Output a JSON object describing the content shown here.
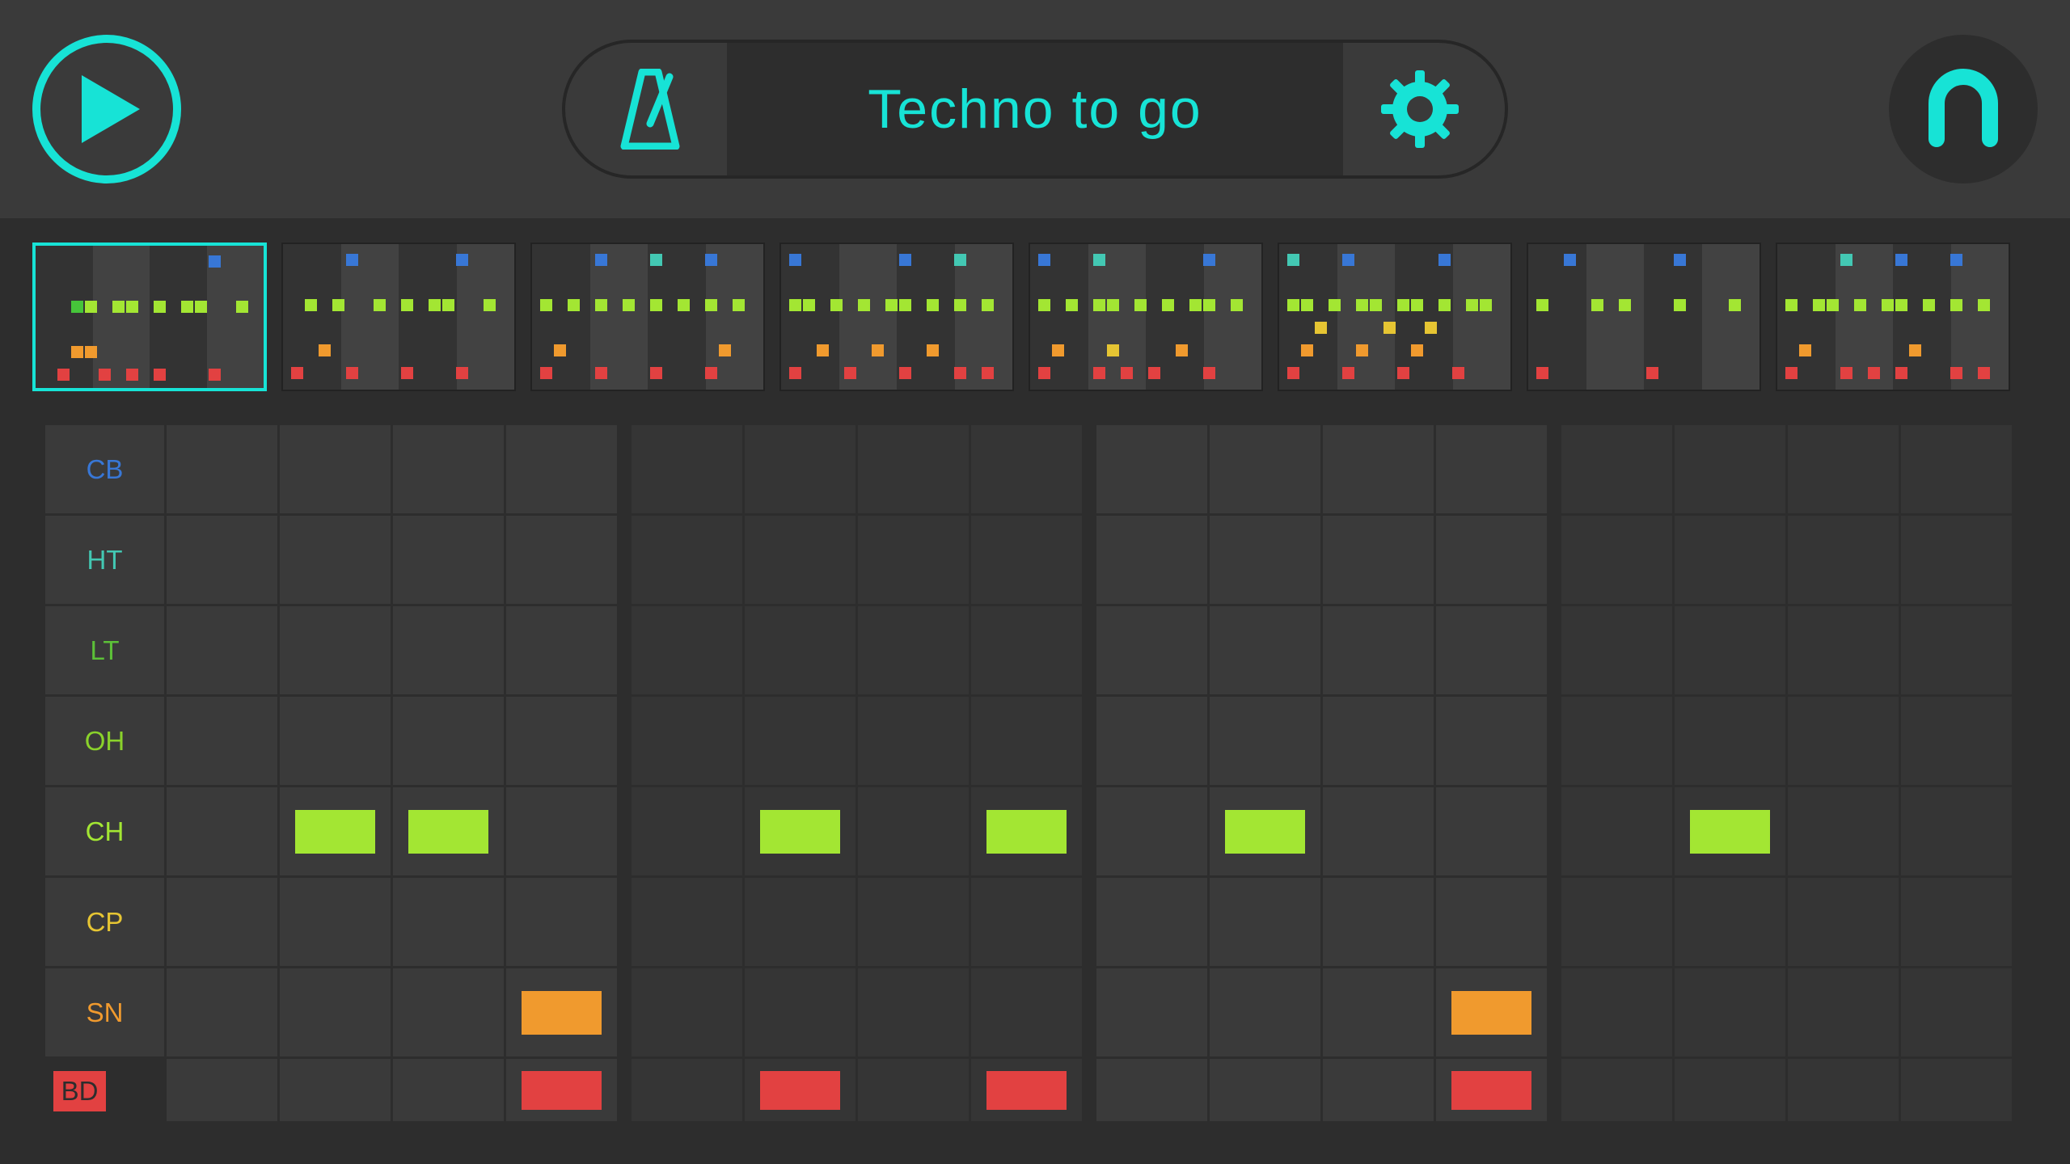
{
  "header": {
    "title": "Techno to go",
    "play_icon": "play",
    "metronome_icon": "metronome",
    "settings_icon": "gear",
    "logo_icon": "arch"
  },
  "colors": {
    "accent": "#17e3d6",
    "cb": "#3877d6",
    "ht": "#43c8b3",
    "lt": "#5cc038",
    "oh": "#8ad22b",
    "ch": "#a3e633",
    "cp": "#e6c533",
    "sn": "#f09a2e",
    "bd": "#e24141"
  },
  "tracks": [
    {
      "id": "cb",
      "label": "CB",
      "steps": [],
      "labelColor": "#3877d6"
    },
    {
      "id": "ht",
      "label": "HT",
      "steps": [],
      "labelColor": "#43c8b3"
    },
    {
      "id": "lt",
      "label": "LT",
      "steps": [],
      "labelColor": "#5cc038"
    },
    {
      "id": "oh",
      "label": "OH",
      "steps": [],
      "labelColor": "#8ad22b"
    },
    {
      "id": "ch",
      "label": "CH",
      "steps": [
        1,
        2,
        5,
        7,
        9,
        13
      ],
      "labelColor": "#a3e633",
      "color": "#a3e633"
    },
    {
      "id": "cp",
      "label": "CP",
      "steps": [],
      "labelColor": "#e6c533"
    },
    {
      "id": "sn",
      "label": "SN",
      "steps": [
        3,
        11
      ],
      "labelColor": "#f09a2e",
      "color": "#f09a2e"
    },
    {
      "id": "bd",
      "label": "BD",
      "steps": [
        3,
        5,
        7,
        11
      ],
      "labelColor": "#e24141",
      "color": "#e24141"
    }
  ],
  "patterns": {
    "active": 0,
    "count": 8,
    "items": [
      {
        "dots": [
          [
            12,
            0,
            "#3877d6"
          ],
          [
            2,
            2,
            "#46c53a"
          ],
          [
            3,
            2,
            "#a3e633"
          ],
          [
            5,
            2,
            "#a3e633"
          ],
          [
            6,
            2,
            "#a3e633"
          ],
          [
            8,
            2,
            "#a3e633"
          ],
          [
            10,
            2,
            "#a3e633"
          ],
          [
            11,
            2,
            "#a3e633"
          ],
          [
            14,
            2,
            "#a3e633"
          ],
          [
            2,
            4,
            "#f09a2e"
          ],
          [
            3,
            4,
            "#f09a2e"
          ],
          [
            1,
            5,
            "#e24141"
          ],
          [
            4,
            5,
            "#e24141"
          ],
          [
            6,
            5,
            "#e24141"
          ],
          [
            8,
            5,
            "#e24141"
          ],
          [
            12,
            5,
            "#e24141"
          ]
        ]
      },
      {
        "dots": [
          [
            4,
            0,
            "#3877d6"
          ],
          [
            12,
            0,
            "#3877d6"
          ],
          [
            1,
            2,
            "#a3e633"
          ],
          [
            3,
            2,
            "#a3e633"
          ],
          [
            6,
            2,
            "#a3e633"
          ],
          [
            8,
            2,
            "#a3e633"
          ],
          [
            10,
            2,
            "#a3e633"
          ],
          [
            11,
            2,
            "#a3e633"
          ],
          [
            14,
            2,
            "#a3e633"
          ],
          [
            2,
            4,
            "#f09a2e"
          ],
          [
            0,
            5,
            "#e24141"
          ],
          [
            4,
            5,
            "#e24141"
          ],
          [
            8,
            5,
            "#e24141"
          ],
          [
            12,
            5,
            "#e24141"
          ]
        ]
      },
      {
        "dots": [
          [
            4,
            0,
            "#3877d6"
          ],
          [
            8,
            0,
            "#43c8b3"
          ],
          [
            12,
            0,
            "#3877d6"
          ],
          [
            0,
            2,
            "#a3e633"
          ],
          [
            2,
            2,
            "#a3e633"
          ],
          [
            4,
            2,
            "#a3e633"
          ],
          [
            6,
            2,
            "#a3e633"
          ],
          [
            8,
            2,
            "#a3e633"
          ],
          [
            10,
            2,
            "#a3e633"
          ],
          [
            12,
            2,
            "#a3e633"
          ],
          [
            14,
            2,
            "#a3e633"
          ],
          [
            1,
            4,
            "#f09a2e"
          ],
          [
            13,
            4,
            "#f09a2e"
          ],
          [
            0,
            5,
            "#e24141"
          ],
          [
            4,
            5,
            "#e24141"
          ],
          [
            8,
            5,
            "#e24141"
          ],
          [
            12,
            5,
            "#e24141"
          ]
        ]
      },
      {
        "dots": [
          [
            0,
            0,
            "#3877d6"
          ],
          [
            8,
            0,
            "#3877d6"
          ],
          [
            12,
            0,
            "#43c8b3"
          ],
          [
            0,
            2,
            "#a3e633"
          ],
          [
            1,
            2,
            "#a3e633"
          ],
          [
            3,
            2,
            "#a3e633"
          ],
          [
            5,
            2,
            "#a3e633"
          ],
          [
            7,
            2,
            "#a3e633"
          ],
          [
            8,
            2,
            "#a3e633"
          ],
          [
            10,
            2,
            "#a3e633"
          ],
          [
            12,
            2,
            "#a3e633"
          ],
          [
            14,
            2,
            "#a3e633"
          ],
          [
            2,
            4,
            "#f09a2e"
          ],
          [
            6,
            4,
            "#f09a2e"
          ],
          [
            10,
            4,
            "#f09a2e"
          ],
          [
            0,
            5,
            "#e24141"
          ],
          [
            4,
            5,
            "#e24141"
          ],
          [
            8,
            5,
            "#e24141"
          ],
          [
            12,
            5,
            "#e24141"
          ],
          [
            14,
            5,
            "#e24141"
          ]
        ]
      },
      {
        "dots": [
          [
            0,
            0,
            "#3877d6"
          ],
          [
            4,
            0,
            "#43c8b3"
          ],
          [
            12,
            0,
            "#3877d6"
          ],
          [
            0,
            2,
            "#a3e633"
          ],
          [
            2,
            2,
            "#a3e633"
          ],
          [
            4,
            2,
            "#a3e633"
          ],
          [
            5,
            2,
            "#a3e633"
          ],
          [
            7,
            2,
            "#a3e633"
          ],
          [
            9,
            2,
            "#a3e633"
          ],
          [
            11,
            2,
            "#a3e633"
          ],
          [
            12,
            2,
            "#a3e633"
          ],
          [
            14,
            2,
            "#a3e633"
          ],
          [
            1,
            4,
            "#f09a2e"
          ],
          [
            5,
            4,
            "#e6c533"
          ],
          [
            10,
            4,
            "#f09a2e"
          ],
          [
            0,
            5,
            "#e24141"
          ],
          [
            4,
            5,
            "#e24141"
          ],
          [
            6,
            5,
            "#e24141"
          ],
          [
            8,
            5,
            "#e24141"
          ],
          [
            12,
            5,
            "#e24141"
          ]
        ]
      },
      {
        "dots": [
          [
            0,
            0,
            "#43c8b3"
          ],
          [
            4,
            0,
            "#3877d6"
          ],
          [
            11,
            0,
            "#3877d6"
          ],
          [
            0,
            2,
            "#a3e633"
          ],
          [
            1,
            2,
            "#a3e633"
          ],
          [
            3,
            2,
            "#a3e633"
          ],
          [
            5,
            2,
            "#a3e633"
          ],
          [
            6,
            2,
            "#a3e633"
          ],
          [
            8,
            2,
            "#a3e633"
          ],
          [
            9,
            2,
            "#a3e633"
          ],
          [
            11,
            2,
            "#a3e633"
          ],
          [
            13,
            2,
            "#a3e633"
          ],
          [
            14,
            2,
            "#a3e633"
          ],
          [
            2,
            3,
            "#e6c533"
          ],
          [
            7,
            3,
            "#e6c533"
          ],
          [
            10,
            3,
            "#e6c533"
          ],
          [
            1,
            4,
            "#f09a2e"
          ],
          [
            5,
            4,
            "#f09a2e"
          ],
          [
            9,
            4,
            "#f09a2e"
          ],
          [
            0,
            5,
            "#e24141"
          ],
          [
            4,
            5,
            "#e24141"
          ],
          [
            8,
            5,
            "#e24141"
          ],
          [
            12,
            5,
            "#e24141"
          ]
        ]
      },
      {
        "dots": [
          [
            2,
            0,
            "#3877d6"
          ],
          [
            10,
            0,
            "#3877d6"
          ],
          [
            0,
            2,
            "#a3e633"
          ],
          [
            4,
            2,
            "#a3e633"
          ],
          [
            6,
            2,
            "#a3e633"
          ],
          [
            10,
            2,
            "#a3e633"
          ],
          [
            14,
            2,
            "#a3e633"
          ],
          [
            0,
            5,
            "#e24141"
          ],
          [
            8,
            5,
            "#e24141"
          ]
        ]
      },
      {
        "dots": [
          [
            4,
            0,
            "#43c8b3"
          ],
          [
            8,
            0,
            "#3877d6"
          ],
          [
            12,
            0,
            "#3877d6"
          ],
          [
            0,
            2,
            "#a3e633"
          ],
          [
            2,
            2,
            "#a3e633"
          ],
          [
            3,
            2,
            "#a3e633"
          ],
          [
            5,
            2,
            "#a3e633"
          ],
          [
            7,
            2,
            "#a3e633"
          ],
          [
            8,
            2,
            "#a3e633"
          ],
          [
            10,
            2,
            "#a3e633"
          ],
          [
            12,
            2,
            "#a3e633"
          ],
          [
            14,
            2,
            "#a3e633"
          ],
          [
            1,
            4,
            "#f09a2e"
          ],
          [
            9,
            4,
            "#f09a2e"
          ],
          [
            0,
            5,
            "#e24141"
          ],
          [
            4,
            5,
            "#e24141"
          ],
          [
            6,
            5,
            "#e24141"
          ],
          [
            8,
            5,
            "#e24141"
          ],
          [
            12,
            5,
            "#e24141"
          ],
          [
            14,
            5,
            "#e24141"
          ]
        ]
      }
    ]
  }
}
